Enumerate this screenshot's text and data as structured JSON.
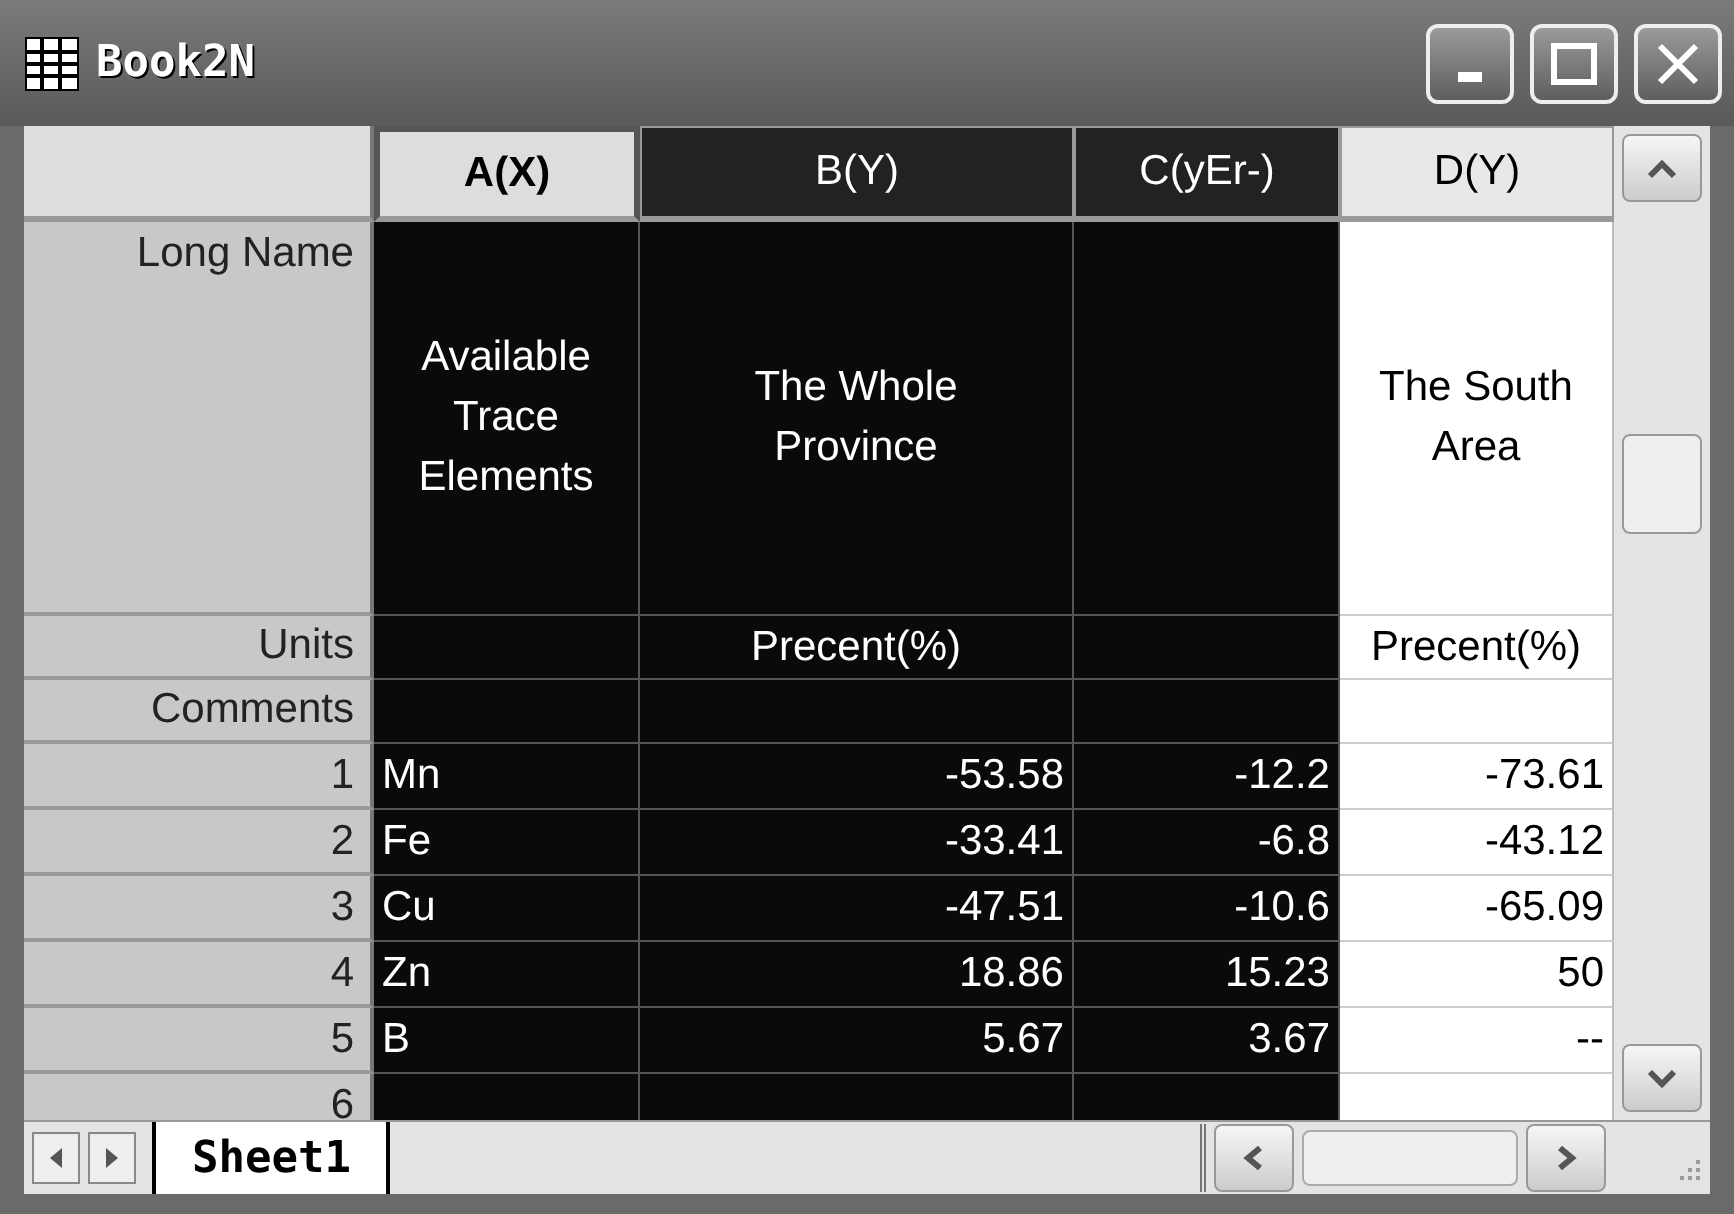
{
  "window": {
    "title": "Book2N"
  },
  "columns": [
    {
      "label": "A(X)",
      "selected": true,
      "current": true
    },
    {
      "label": "B(Y)",
      "selected": true,
      "current": false
    },
    {
      "label": "C(yEr-)",
      "selected": true,
      "current": false
    },
    {
      "label": "D(Y)",
      "selected": false,
      "current": false
    }
  ],
  "label_rows": [
    {
      "label": "Long Name",
      "cells": [
        "Available Trace Elements",
        "The Whole Province",
        "",
        "The South Area"
      ]
    },
    {
      "label": "Units",
      "cells": [
        "",
        "Precent(%)",
        "",
        "Precent(%)"
      ]
    },
    {
      "label": "Comments",
      "cells": [
        "",
        "",
        "",
        ""
      ]
    }
  ],
  "rows": [
    {
      "index": "1",
      "cells": [
        "Mn",
        "-53.58",
        "-12.2",
        "-73.61"
      ]
    },
    {
      "index": "2",
      "cells": [
        "Fe",
        "-33.41",
        "-6.8",
        "-43.12"
      ]
    },
    {
      "index": "3",
      "cells": [
        "Cu",
        "-47.51",
        "-10.6",
        "-65.09"
      ]
    },
    {
      "index": "4",
      "cells": [
        "Zn",
        "18.86",
        "15.23",
        "50"
      ]
    },
    {
      "index": "5",
      "cells": [
        "B",
        "5.67",
        "3.67",
        "--"
      ]
    },
    {
      "index": "6",
      "cells": [
        "",
        "",
        "",
        ""
      ]
    }
  ],
  "sheet_tabs": [
    {
      "label": "Sheet1",
      "selected": true
    }
  ]
}
